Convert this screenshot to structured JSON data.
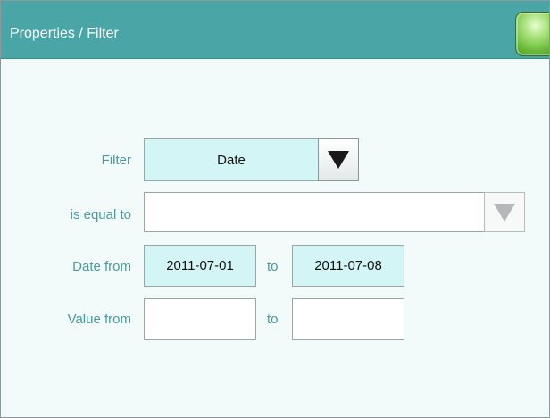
{
  "header": {
    "title": "Properties / Filter"
  },
  "form": {
    "filter": {
      "label": "Filter",
      "value": "Date"
    },
    "is_equal_to": {
      "label": "is equal to",
      "value": ""
    },
    "date_range": {
      "label": "Date from",
      "from": "2011-07-01",
      "to_label": "to",
      "to": "2011-07-08"
    },
    "value_range": {
      "label": "Value from",
      "from": "",
      "to_label": "to",
      "to": ""
    }
  },
  "colors": {
    "titlebar": "#4aa6a6",
    "background": "#f3fafa",
    "label": "#4a9a9a",
    "filled_field": "#d4f5f5",
    "ok_button": "#6bbd3a"
  },
  "icons": {
    "ok": "ok-button-icon",
    "dropdown_active": "triangle-down-icon",
    "dropdown_disabled": "triangle-down-icon"
  }
}
